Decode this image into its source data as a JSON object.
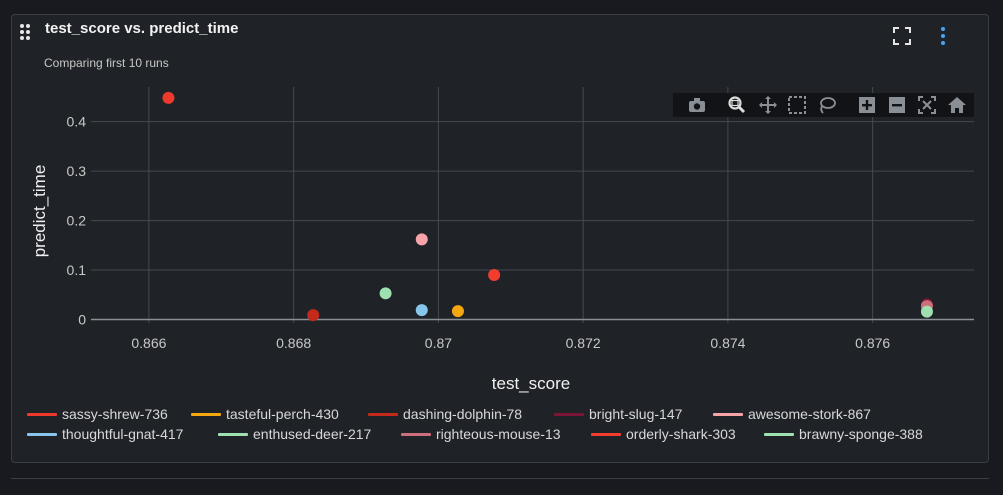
{
  "header": {
    "title": "test_score vs. predict_time",
    "subtitle": "Comparing first 10 runs"
  },
  "icons": {
    "drag": "drag-handle-icon",
    "expand": "expand-icon",
    "menu": "more-vertical-icon",
    "modebar": [
      "camera-icon",
      "zoom-icon",
      "pan-icon",
      "box-select-icon",
      "lasso-select-icon",
      "zoom-in-icon",
      "zoom-out-icon",
      "autoscale-icon",
      "reset-axes-icon"
    ]
  },
  "colors": {
    "background": "#1f2227",
    "grid": "#454a52",
    "accent": "#4aa3f0"
  },
  "chart_data": {
    "type": "scatter",
    "xlabel": "test_score",
    "ylabel": "predict_time",
    "xlim": [
      0.8652,
      0.8774
    ],
    "ylim": [
      -0.007,
      0.47
    ],
    "xticks": [
      0.866,
      0.868,
      0.87,
      0.872,
      0.874,
      0.876
    ],
    "xtick_labels": [
      "0.866",
      "0.868",
      "0.87",
      "0.872",
      "0.874",
      "0.876"
    ],
    "yticks": [
      0,
      0.1,
      0.2,
      0.3,
      0.4
    ],
    "ytick_labels": [
      "0",
      "0.1",
      "0.2",
      "0.3",
      "0.4"
    ],
    "grid": true,
    "legend_position": "bottom",
    "series": [
      {
        "name": "sassy-shrew-736",
        "color": "#ee3a2c",
        "x": [
          0.86627
        ],
        "y": [
          0.448
        ]
      },
      {
        "name": "tasteful-perch-430",
        "color": "#f5a70f",
        "x": [
          0.87027
        ],
        "y": [
          0.017
        ]
      },
      {
        "name": "dashing-dolphin-78",
        "color": "#c42a1c",
        "x": [
          0.86827
        ],
        "y": [
          0.009
        ]
      },
      {
        "name": "bright-slug-147",
        "color": "#7a1536",
        "x": [
          0.87675
        ],
        "y": [
          0.031
        ]
      },
      {
        "name": "awesome-stork-867",
        "color": "#f6a4a8",
        "x": [
          0.86977
        ],
        "y": [
          0.162
        ]
      },
      {
        "name": "thoughtful-gnat-417",
        "color": "#87c6ea",
        "x": [
          0.86977
        ],
        "y": [
          0.019
        ]
      },
      {
        "name": "enthused-deer-217",
        "color": "#9ee0b0",
        "x": [
          0.86927
        ],
        "y": [
          0.053
        ]
      },
      {
        "name": "righteous-mouse-13",
        "color": "#cc6e7c",
        "x": [
          0.87675
        ],
        "y": [
          0.027
        ]
      },
      {
        "name": "orderly-shark-303",
        "color": "#f23d2f",
        "x": [
          0.87077
        ],
        "y": [
          0.09
        ]
      },
      {
        "name": "brawny-sponge-388",
        "color": "#9ee0b0",
        "x": [
          0.87675
        ],
        "y": [
          0.016
        ]
      }
    ]
  }
}
